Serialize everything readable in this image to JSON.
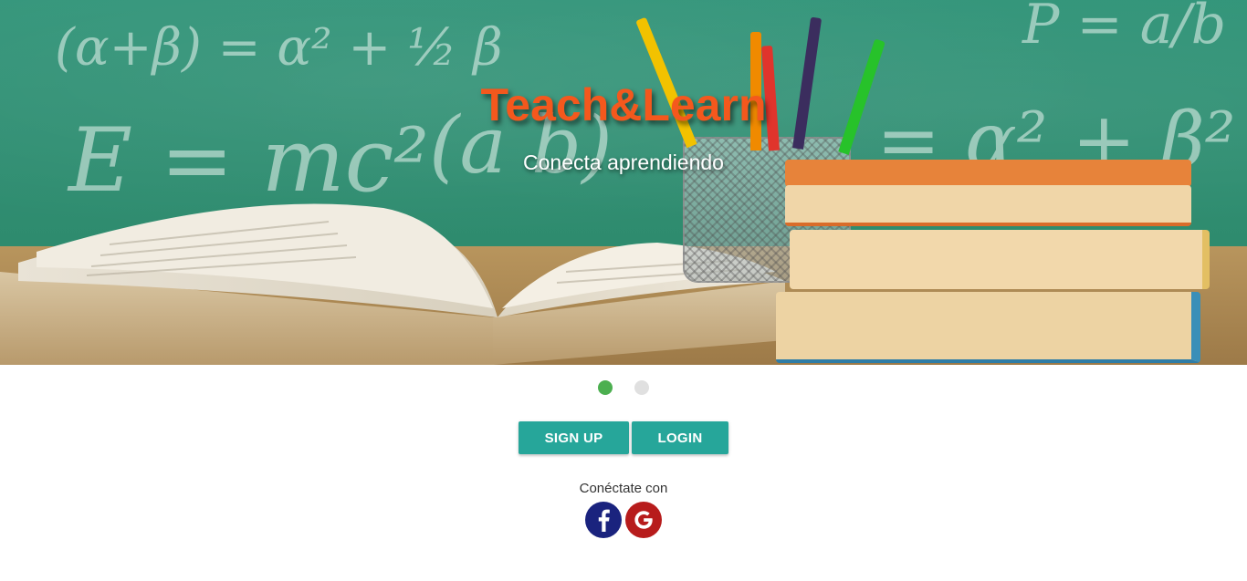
{
  "hero": {
    "title": "Teach&Learn",
    "subtitle": "Conecta aprendiendo",
    "title_color": "#f4581d",
    "chalk": [
      "(α+β) = α² + ½ β",
      "E = mc²",
      "(a b)",
      "P = a/b",
      "= α² + β²"
    ]
  },
  "carousel": {
    "indicators": [
      {
        "state": "active",
        "color": "#4caf50"
      },
      {
        "state": "inactive",
        "color": "#e0e0e0"
      }
    ]
  },
  "actions": {
    "signup_label": "SIGN UP",
    "login_label": "LOGIN",
    "accent": "#26a69a"
  },
  "social": {
    "label": "Conéctate con",
    "facebook": {
      "icon": "facebook-icon",
      "glyph": "f",
      "color": "#1a237e"
    },
    "google": {
      "icon": "google-icon",
      "glyph": "G",
      "color": "#b71c1c"
    }
  }
}
